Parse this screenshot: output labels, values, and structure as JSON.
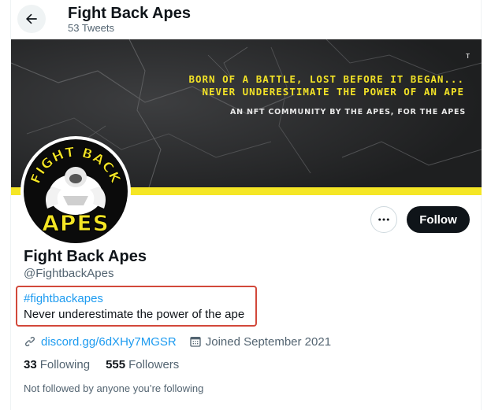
{
  "header": {
    "title": "Fight Back Apes",
    "tweet_count": "53 Tweets",
    "back_icon": "arrow-left-icon"
  },
  "banner": {
    "line1": "BORN OF A BATTLE, LOST BEFORE IT BEGAN...",
    "line2": "NEVER UNDERESTIMATE THE POWER OF AN APE",
    "line3": "AN NFT COMMUNITY BY THE APES, FOR THE APES",
    "mark": "T",
    "accent_color": "#f5e625"
  },
  "avatar": {
    "text_top": "FIGHT BACK",
    "text_bottom": "APES"
  },
  "actions": {
    "more_icon": "more-horizontal-icon",
    "follow_label": "Follow"
  },
  "profile": {
    "name": "Fight Back Apes",
    "handle": "@FightbackApes",
    "hashtag": "#fightbackapes",
    "bio": "Never underestimate the power of the ape",
    "link": "discord.gg/6dXHy7MGSR",
    "link_icon": "link-icon",
    "joined": "Joined September 2021",
    "joined_icon": "calendar-icon"
  },
  "stats": {
    "following_count": "33",
    "following_label": "Following",
    "followers_count": "555",
    "followers_label": "Followers"
  },
  "footer": {
    "not_followed": "Not followed by anyone you’re following"
  },
  "colors": {
    "link": "#1d9bf0",
    "secondary_text": "#536471",
    "highlight_border": "#d2483a"
  }
}
